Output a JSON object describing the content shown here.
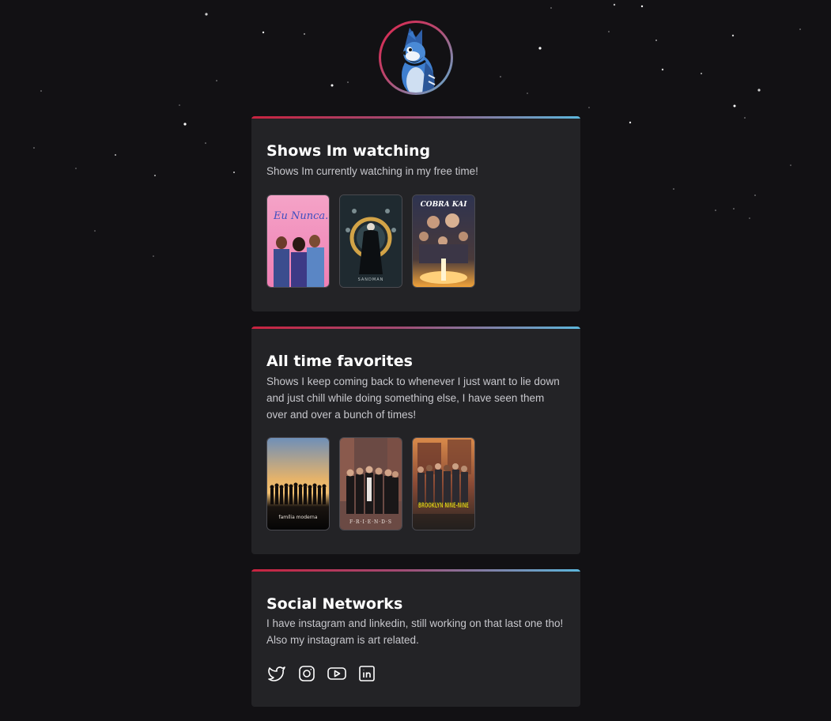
{
  "cards": [
    {
      "title": "Shows Im watching",
      "description": "Shows Im currently watching in my free time!",
      "posters": [
        {
          "name": "eu-nunca-poster",
          "text": "Eu Nunca..."
        },
        {
          "name": "sandman-poster",
          "text": "SANDMAN"
        },
        {
          "name": "cobra-kai-poster",
          "text": "COBRA KAI"
        }
      ]
    },
    {
      "title": "All time favorites",
      "description": "Shows I keep coming back to whenever I just want to lie down and just chill while doing something else, I have seen them over and over a bunch of times!",
      "posters": [
        {
          "name": "familia-moderna-poster",
          "text": "família moderna"
        },
        {
          "name": "friends-poster",
          "text": "F·R·I·E·N·D·S"
        },
        {
          "name": "brooklyn-nine-nine-poster",
          "text": "BROOKLYN NINE-NINE"
        }
      ]
    },
    {
      "title": "Social Networks",
      "description": "I have instagram and linkedin, still working on that last one tho! Also my instagram is art related.",
      "socials": [
        "twitter-icon",
        "instagram-icon",
        "youtube-icon",
        "linkedin-icon"
      ]
    }
  ],
  "colors": {
    "background": "#121114",
    "card": "#232326",
    "accent_start": "#c8233f",
    "accent_end": "#5cb6dc"
  }
}
